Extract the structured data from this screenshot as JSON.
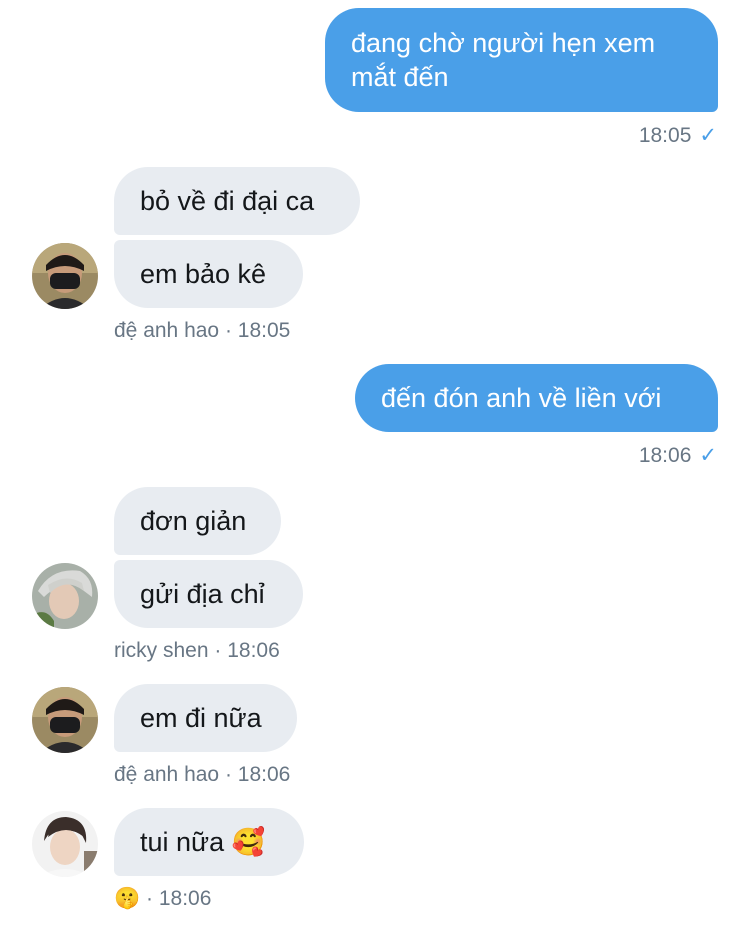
{
  "messages": [
    {
      "text_line1": "đang chờ người hẹn xem",
      "text_line2": "mắt đến",
      "time": "18:05"
    },
    {
      "bubble1": "bỏ về đi đại ca",
      "bubble2": "em bảo kê",
      "sender": "đệ anh hao",
      "time": "18:05"
    },
    {
      "text": "đến đón anh về liền với",
      "time": "18:06"
    },
    {
      "bubble1": "đơn giản",
      "bubble2": "gửi địa chỉ",
      "sender": "ricky shen",
      "time": "18:06"
    },
    {
      "bubble1": "em đi nữa",
      "sender": "đệ anh hao",
      "time": "18:06"
    },
    {
      "bubble1": "tui nữa",
      "emoji": "🥰",
      "sender_emoji": "🤫",
      "time": "18:06"
    }
  ],
  "separator": "·",
  "sent_icon": "checkmark-icon",
  "colors": {
    "outgoing_bubble": "#4a9fe8",
    "incoming_bubble": "#e8ecf1",
    "meta_text": "#687684",
    "check": "#4a9fe8"
  }
}
